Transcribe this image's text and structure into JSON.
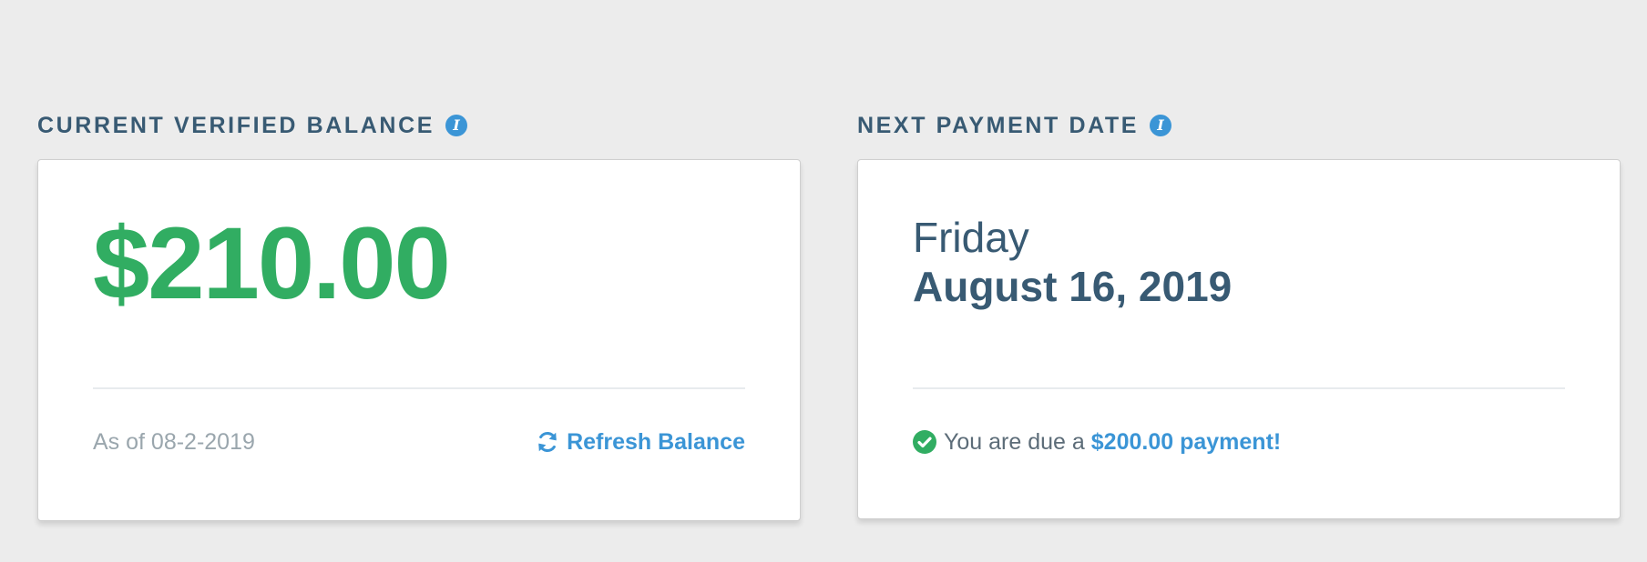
{
  "balance": {
    "heading": "CURRENT VERIFIED BALANCE",
    "info_icon": "info-icon",
    "amount": "$210.00",
    "as_of": "As of 08-2-2019",
    "refresh_label": "Refresh Balance",
    "refresh_icon": "refresh-icon"
  },
  "payment": {
    "heading": "NEXT PAYMENT DATE",
    "info_icon": "info-icon",
    "day": "Friday",
    "date": "August 16, 2019",
    "due_prefix": "You are due a",
    "due_amount": "$200.00 payment!",
    "check_icon": "check-circle-icon"
  },
  "colors": {
    "background": "#ececec",
    "heading": "#385a73",
    "amount_green": "#31ad62",
    "link_blue": "#3b95d6",
    "muted": "#9aa6ad"
  }
}
